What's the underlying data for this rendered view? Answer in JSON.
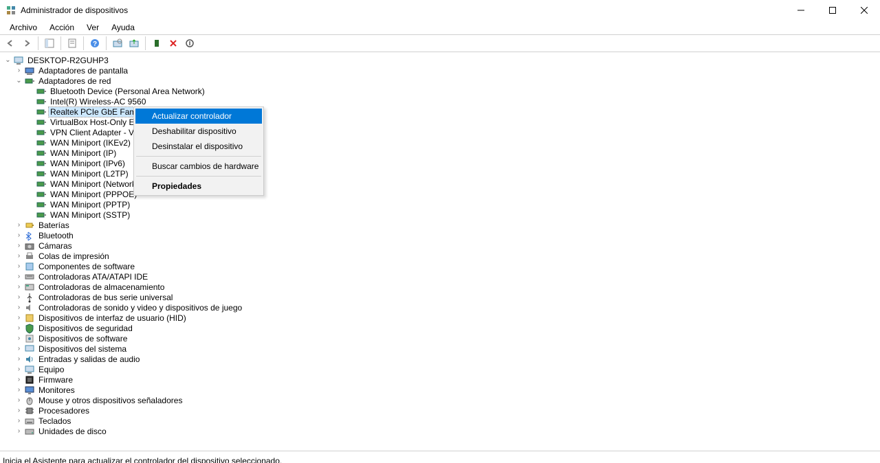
{
  "window": {
    "title": "Administrador de dispositivos"
  },
  "menu": {
    "archivo": "Archivo",
    "accion": "Acción",
    "ver": "Ver",
    "ayuda": "Ayuda"
  },
  "root": {
    "name": "DESKTOP-R2GUHP3"
  },
  "categories": {
    "display": "Adaptadores de pantalla",
    "network": "Adaptadores de red",
    "batteries": "Baterías",
    "bluetooth": "Bluetooth",
    "cameras": "Cámaras",
    "printqueues": "Colas de impresión",
    "softwarecomp": "Componentes de software",
    "ide": "Controladoras ATA/ATAPI IDE",
    "storage": "Controladoras de almacenamiento",
    "usb": "Controladoras de bus serie universal",
    "sound": "Controladoras de sonido y video y dispositivos de juego",
    "hid": "Dispositivos de interfaz de usuario (HID)",
    "security": "Dispositivos de seguridad",
    "softwaredev": "Dispositivos de software",
    "system": "Dispositivos del sistema",
    "audio": "Entradas y salidas de audio",
    "computer": "Equipo",
    "firmware": "Firmware",
    "monitors": "Monitores",
    "mice": "Mouse y otros dispositivos señaladores",
    "processors": "Procesadores",
    "keyboards": "Teclados",
    "disks": "Unidades de disco"
  },
  "network_devices": {
    "bt": "Bluetooth Device (Personal Area Network)",
    "intel": "Intel(R) Wireless-AC 9560",
    "realtek": "Realtek PCIe GbE Family Co",
    "vbox": "VirtualBox Host-Only Ethern",
    "vpn": "VPN Client Adapter - VPN2",
    "ikev2": "WAN Miniport (IKEv2)",
    "ip": "WAN Miniport (IP)",
    "ipv6": "WAN Miniport (IPv6)",
    "l2tp": "WAN Miniport (L2TP)",
    "netmon": "WAN Miniport (Network Monitor)",
    "pppoe": "WAN Miniport (PPPOE)",
    "pptp": "WAN Miniport (PPTP)",
    "sstp": "WAN Miniport (SSTP)"
  },
  "contextmenu": {
    "update": "Actualizar controlador",
    "disable": "Deshabilitar dispositivo",
    "uninstall": "Desinstalar el dispositivo",
    "scan": "Buscar cambios de hardware",
    "properties": "Propiedades"
  },
  "status": "Inicia el Asistente para actualizar el controlador del dispositivo seleccionado."
}
